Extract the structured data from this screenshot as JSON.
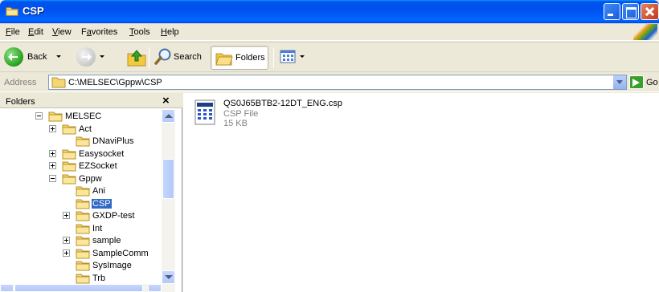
{
  "window": {
    "title": "CSP"
  },
  "menu": [
    {
      "label": "File",
      "accel": "F"
    },
    {
      "label": "Edit",
      "accel": "E"
    },
    {
      "label": "View",
      "accel": "V"
    },
    {
      "label": "Favorites",
      "accel": "a"
    },
    {
      "label": "Tools",
      "accel": "T"
    },
    {
      "label": "Help",
      "accel": "H"
    }
  ],
  "toolbar": {
    "back_label": "Back",
    "search_label": "Search",
    "folders_label": "Folders"
  },
  "address": {
    "label": "Address",
    "path": "C:\\MELSEC\\Gppw\\CSP",
    "go_label": "Go"
  },
  "folders_pane": {
    "title": "Folders",
    "tree": [
      {
        "label": "MELSEC",
        "expander": "minus"
      },
      {
        "label": "Act",
        "expander": "plus"
      },
      {
        "label": "DNaviPlus",
        "expander": "none"
      },
      {
        "label": "Easysocket",
        "expander": "plus"
      },
      {
        "label": "EZSocket",
        "expander": "plus"
      },
      {
        "label": "Gppw",
        "expander": "minus"
      },
      {
        "label": "Ani",
        "expander": "none"
      },
      {
        "label": "CSP",
        "expander": "none",
        "selected": true
      },
      {
        "label": "GXDP-test",
        "expander": "plus"
      },
      {
        "label": "Int",
        "expander": "none"
      },
      {
        "label": "sample",
        "expander": "plus"
      },
      {
        "label": "SampleComm",
        "expander": "plus"
      },
      {
        "label": "SysImage",
        "expander": "none"
      },
      {
        "label": "Trb",
        "expander": "none"
      }
    ]
  },
  "files": [
    {
      "name": "QS0J65BTB2-12DT_ENG.csp",
      "type": "CSP File",
      "size": "15 KB"
    }
  ],
  "colors": {
    "title_bar": "#0054e3",
    "selection": "#316ac5",
    "window_bg": "#ece9d8"
  }
}
